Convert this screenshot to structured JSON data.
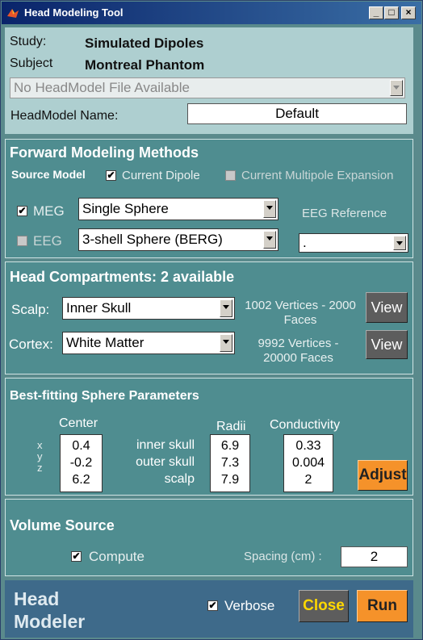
{
  "window": {
    "title": "Head Modeling Tool",
    "buttons": {
      "minimize": "_",
      "maximize": "□",
      "close": "×"
    }
  },
  "header": {
    "study_label": "Study:",
    "study_value": "Simulated Dipoles",
    "subject_label": "Subject",
    "subject_value": "Montreal Phantom",
    "headmodel_file": "No HeadModel File Available",
    "headmodel_name_label": "HeadModel Name:",
    "headmodel_name_value": "Default"
  },
  "forward": {
    "title": "Forward Modeling Methods",
    "source_model_label": "Source Model",
    "current_dipole_label": "Current Dipole",
    "current_dipole_checked": true,
    "multipole_label": "Current Multipole Expansion",
    "multipole_checked": false,
    "meg_label": "MEG",
    "meg_checked": true,
    "meg_method": "Single Sphere",
    "eeg_label": "EEG",
    "eeg_checked": false,
    "eeg_method": "3-shell Sphere (BERG)",
    "eeg_reference_label": "EEG Reference",
    "eeg_reference_value": "."
  },
  "compartments": {
    "title": "Head Compartments: 2 available",
    "scalp_label": "Scalp:",
    "scalp_value": "Inner Skull",
    "scalp_info": "1002 Vertices - 2000 Faces",
    "cortex_label": "Cortex:",
    "cortex_value": "White Matter",
    "cortex_info": "9992 Vertices - 20000 Faces",
    "view_label": "View"
  },
  "sphere": {
    "title": "Best-fitting Sphere Parameters",
    "center_header": "Center",
    "radii_header": "Radii",
    "conductivity_header": "Conductivity",
    "axes": [
      "x",
      "y",
      "z"
    ],
    "center": [
      "0.4",
      "-0.2",
      "6.2"
    ],
    "layers": [
      "inner skull",
      "outer skull",
      "scalp"
    ],
    "radii": [
      "6.9",
      "7.3",
      "7.9"
    ],
    "conductivity": [
      "0.33",
      "0.004",
      "2"
    ],
    "adjust_label": "Adjust"
  },
  "volume": {
    "title": "Volume Source",
    "compute_label": "Compute",
    "compute_checked": true,
    "spacing_label": "Spacing (cm) :",
    "spacing_value": "2"
  },
  "footer": {
    "brand_line1": "Head",
    "brand_line2": "Modeler",
    "verbose_label": "Verbose",
    "verbose_checked": true,
    "close_label": "Close",
    "run_label": "Run"
  },
  "colors": {
    "panel": "#4f8d90",
    "header_panel": "#aecfd0",
    "footer": "#3e6a8a",
    "accent_button": "#f5922a",
    "close_text": "#ffd800"
  }
}
